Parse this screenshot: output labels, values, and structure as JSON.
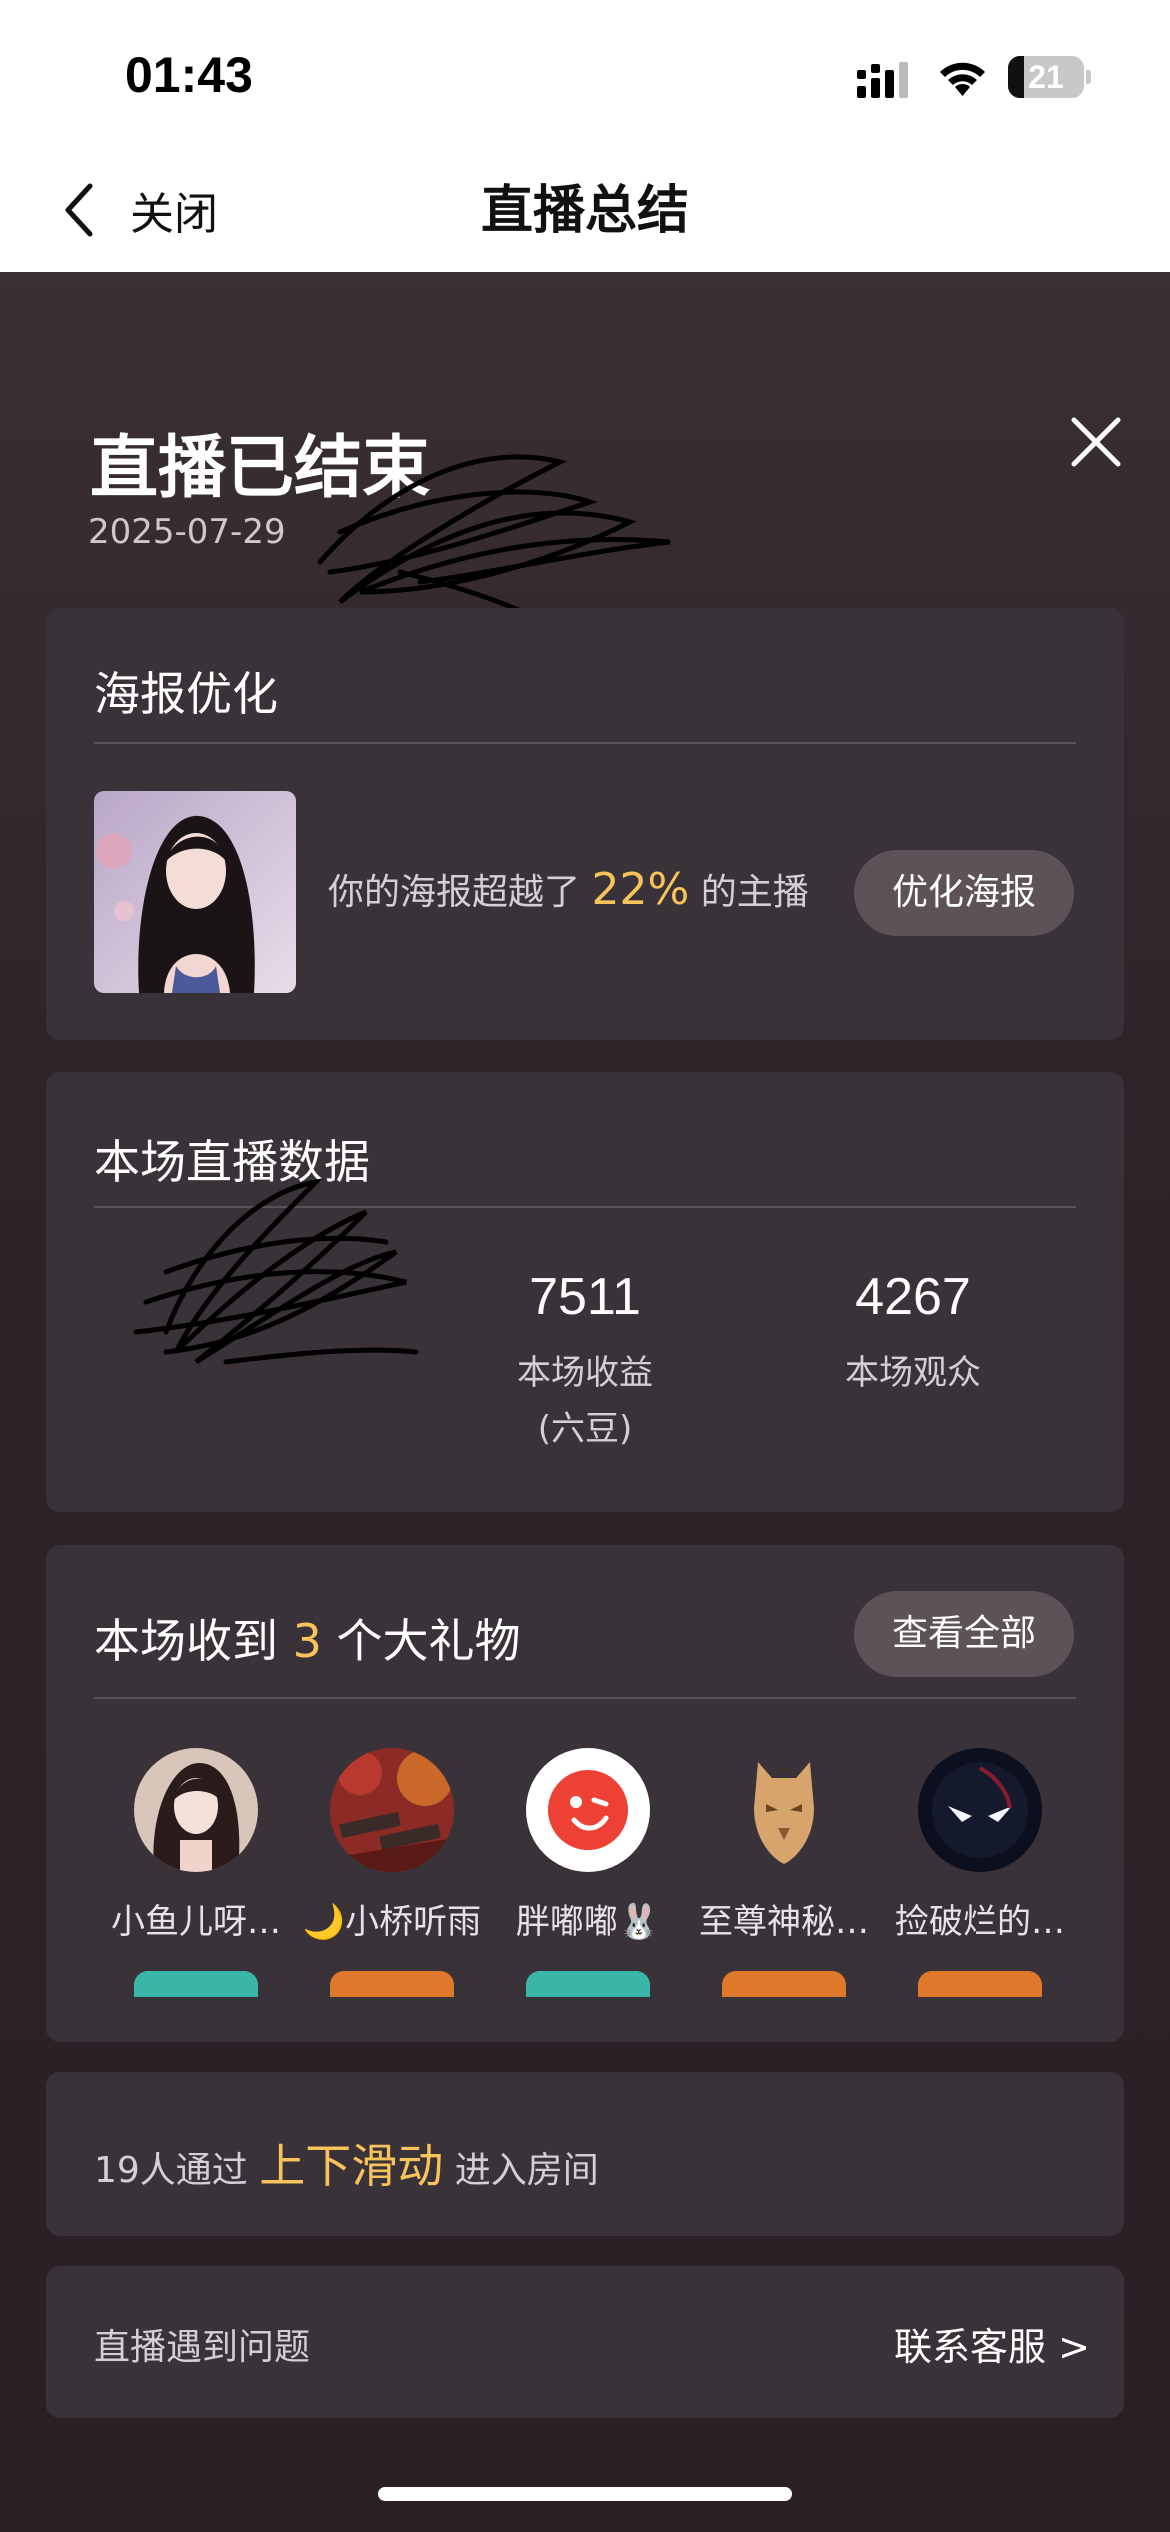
{
  "status_bar": {
    "time": "01:43",
    "battery": "21",
    "battery_level": 0.21
  },
  "nav": {
    "back_label": "关闭",
    "title": "直播总结"
  },
  "summary": {
    "heading": "直播已结束",
    "date": "2025-07-29"
  },
  "poster_card": {
    "title": "海报优化",
    "text_before": "你的海报超越了",
    "percent": "22%",
    "text_after": "的主播",
    "button": "优化海报"
  },
  "stats_card": {
    "title": "本场直播数据",
    "stats": [
      {
        "value": "7511",
        "label": "本场收益",
        "sub": "(六豆)"
      },
      {
        "value": "4267",
        "label": "本场观众"
      }
    ]
  },
  "gifts_card": {
    "title_before": "本场收到",
    "count": "3",
    "title_after": "个大礼物",
    "button": "查看全部",
    "senders": [
      {
        "name": "小鱼儿呀…"
      },
      {
        "name": "🌙小桥听雨"
      },
      {
        "name": "胖嘟嘟🐰"
      },
      {
        "name": "至尊神秘…"
      },
      {
        "name": "捡破烂的…"
      }
    ]
  },
  "swipe_card": {
    "prefix": "19人通过",
    "highlight": "上下滑动",
    "suffix": "进入房间"
  },
  "help_card": {
    "label": "直播遇到问题",
    "link": "联系客服 >"
  },
  "colors": {
    "accent": "#f7c35a",
    "card": "#3a3239",
    "background": "#2b2128"
  }
}
